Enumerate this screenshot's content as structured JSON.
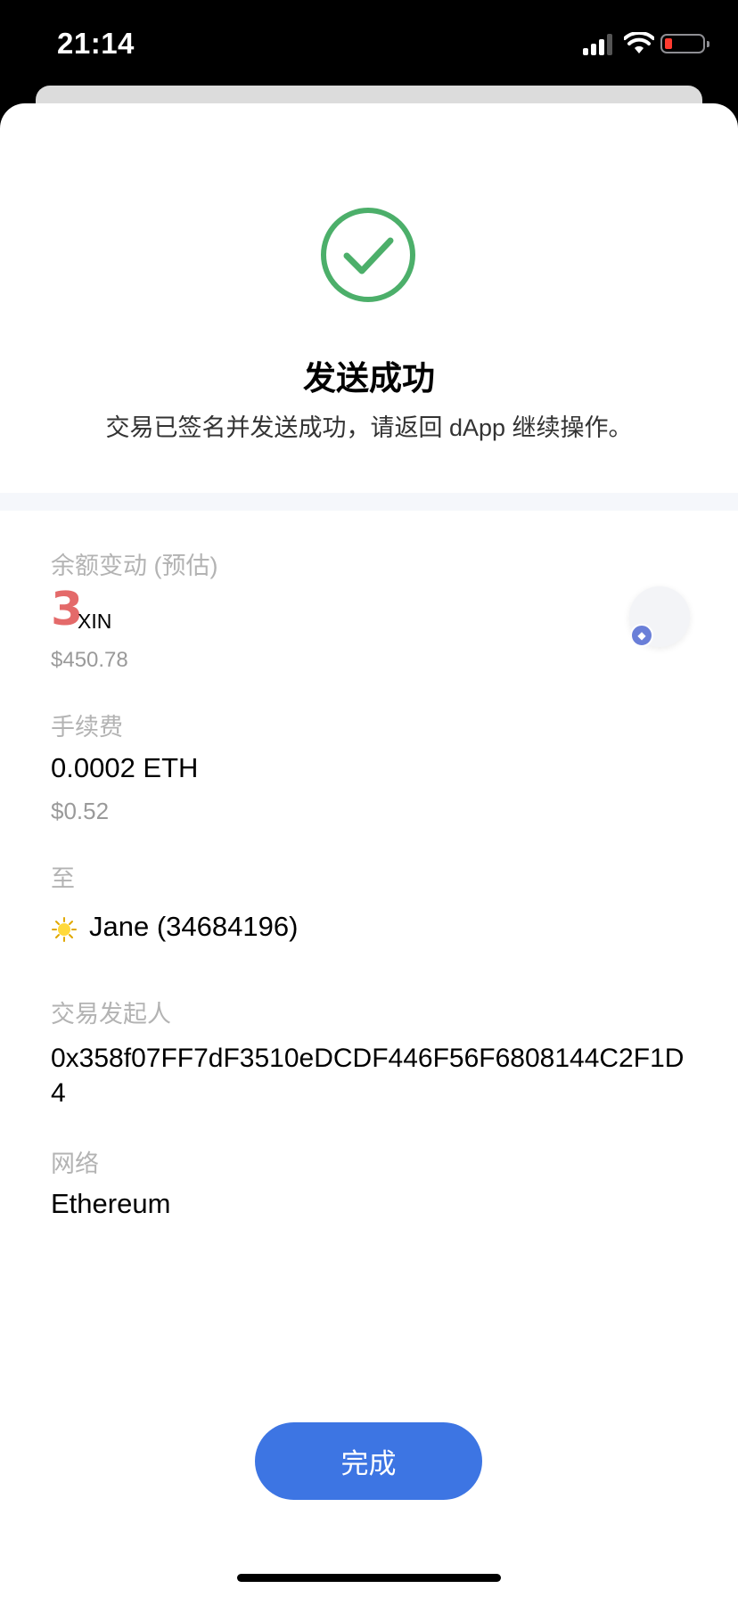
{
  "status_bar": {
    "time": "21:14"
  },
  "result": {
    "title": "发送成功",
    "subtitle": "交易已签名并发送成功，请返回 dApp 继续操作。"
  },
  "balance_change": {
    "label": "余额变动 (预估)",
    "amount": "3",
    "symbol": "XIN",
    "usd": "$450.78",
    "chain_icon": "ethereum-icon"
  },
  "fee": {
    "label": "手续费",
    "amount": "0.0002 ETH",
    "usd": "$0.52"
  },
  "to": {
    "label": "至",
    "name": "Jane (34684196)",
    "avatar_icon": "sun-emoji-avatar"
  },
  "initiator": {
    "label": "交易发起人",
    "address": "0x358f07FF7dF3510eDCDF446F56F6808144C2F1D4"
  },
  "network": {
    "label": "网络",
    "value": "Ethereum"
  },
  "actions": {
    "done": "完成"
  },
  "colors": {
    "success_green": "#4caf6a",
    "primary_blue": "#3d75e3",
    "amount_red": "#e46a6a",
    "label_gray": "#b3b3b3"
  }
}
